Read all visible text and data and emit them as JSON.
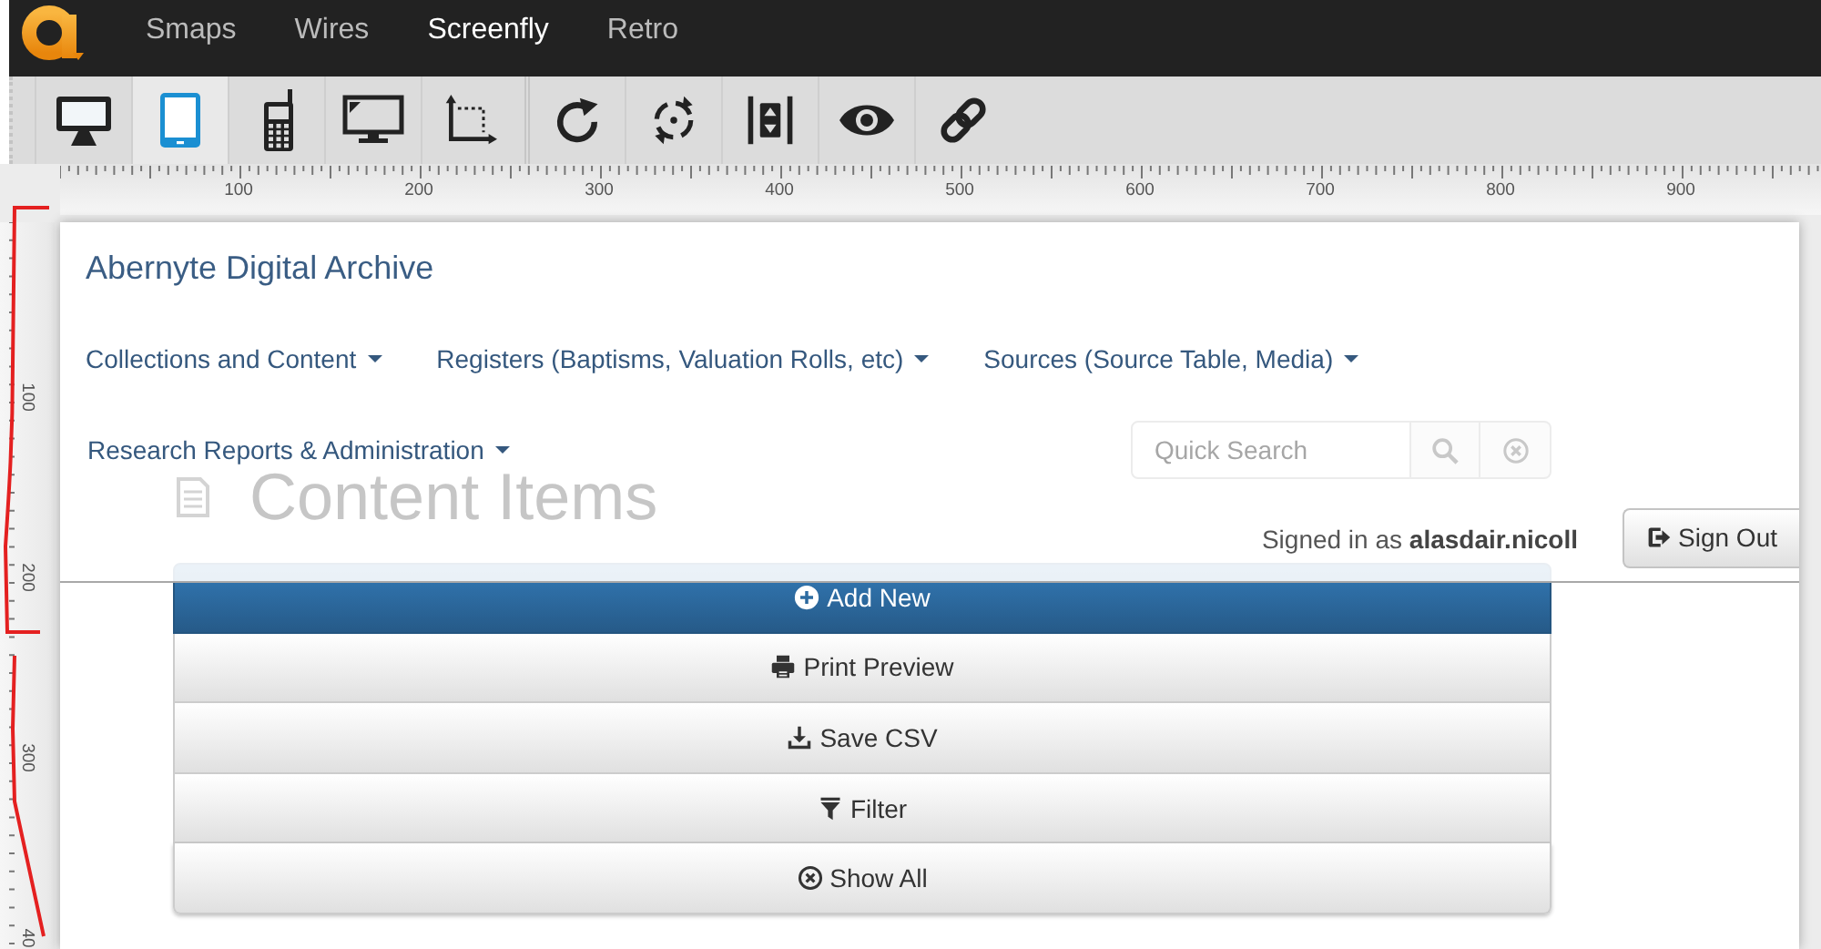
{
  "app_bar": {
    "apps": [
      {
        "label": "Smaps",
        "selected": false
      },
      {
        "label": "Wires",
        "selected": false
      },
      {
        "label": "Screenfly",
        "selected": true
      },
      {
        "label": "Retro",
        "selected": false
      }
    ]
  },
  "toolbar": {
    "device_buttons": [
      {
        "selected": false
      },
      {
        "selected": true
      },
      {
        "selected": false
      },
      {
        "selected": false
      },
      {
        "selected": false
      }
    ]
  },
  "horizontal_ruler": {
    "labels": [
      "100",
      "200",
      "300",
      "400",
      "500",
      "600",
      "700",
      "800",
      "900"
    ]
  },
  "vertical_ruler": {
    "labels": [
      "100",
      "200",
      "300",
      "40"
    ]
  },
  "site": {
    "brand": "Abernyte Digital Archive",
    "menus": [
      "Collections and Content",
      "Registers (Baptisms, Valuation Rolls, etc)",
      "Sources (Source Table, Media)",
      "Research Reports & Administration"
    ],
    "signed_in": "Signed in as **alasdair.nicoll**",
    "sign_out": "Sign Out"
  },
  "page": {
    "heading": "Content Items",
    "quick_search": {
      "placeholder": "Quick Search"
    },
    "actions": [
      {
        "label": "Add New",
        "kind": "primary"
      },
      {
        "label": "Print Preview",
        "kind": "default"
      },
      {
        "label": "Save CSV",
        "kind": "default"
      },
      {
        "label": "Filter",
        "kind": "default"
      },
      {
        "label": "Show All",
        "kind": "default"
      }
    ]
  }
}
